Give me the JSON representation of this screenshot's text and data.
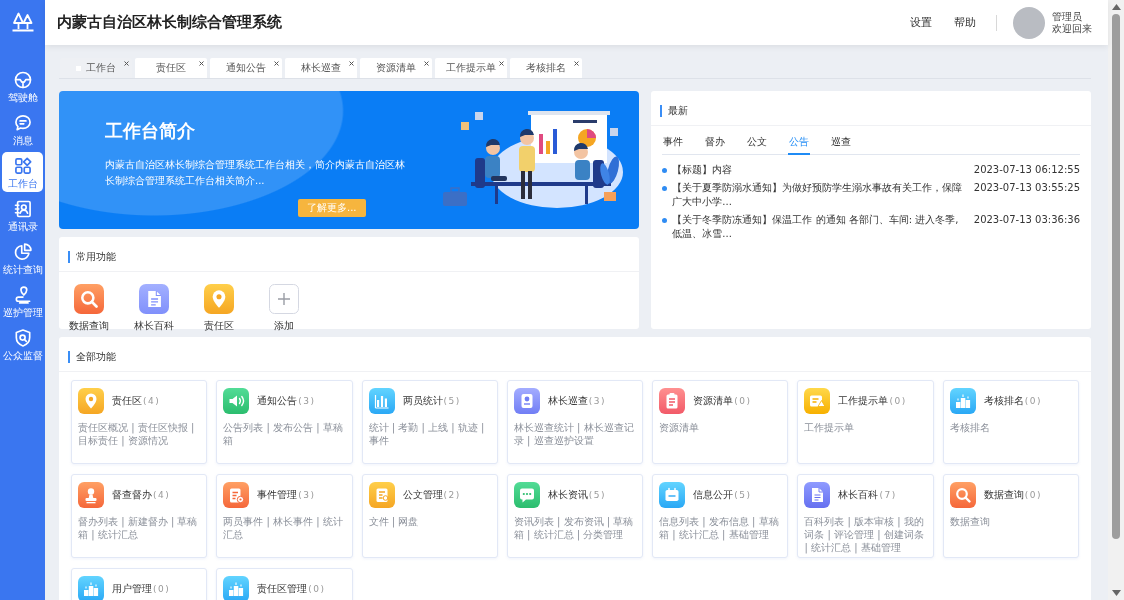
{
  "sidebar": {
    "items": [
      {
        "label": "驾驶舱",
        "selected": false
      },
      {
        "label": "消息",
        "selected": false
      },
      {
        "label": "工作台",
        "selected": true
      },
      {
        "label": "通讯录",
        "selected": false
      },
      {
        "label": "统计查询",
        "selected": false
      },
      {
        "label": "巡护管理",
        "selected": false
      },
      {
        "label": "公众监督",
        "selected": false
      }
    ]
  },
  "header": {
    "title": "内蒙古自治区林长制综合管理系统",
    "links": [
      "设置",
      "帮助"
    ],
    "user": {
      "name": "管理员",
      "greeting": "欢迎回来"
    }
  },
  "tabs": [
    {
      "label": "工作台",
      "selected": true
    },
    {
      "label": "责任区",
      "selected": false
    },
    {
      "label": "通知公告",
      "selected": false
    },
    {
      "label": "林长巡查",
      "selected": false
    },
    {
      "label": "资源清单",
      "selected": false
    },
    {
      "label": "工作提示单",
      "selected": false
    },
    {
      "label": "考核排名",
      "selected": false
    }
  ],
  "banner": {
    "title": "工作台简介",
    "description": "内蒙古自治区林长制综合管理系统工作台相关，简介内蒙古自治区林长制综合管理系统工作台相关简介...",
    "button": "了解更多..."
  },
  "news": {
    "title": "最新",
    "tabs": [
      {
        "label": "事件",
        "selected": false
      },
      {
        "label": "督办",
        "selected": false
      },
      {
        "label": "公文",
        "selected": false
      },
      {
        "label": "公告",
        "selected": true
      },
      {
        "label": "巡查",
        "selected": false
      }
    ],
    "items": [
      {
        "title": "【标题】内容",
        "date": "2023-07-13 06:12:55"
      },
      {
        "title": "【关于夏季防溺水通知】为做好预防学生溺水事故有关工作，保障广大中小学...",
        "date": "2023-07-13 03:55:25"
      },
      {
        "title": "【关于冬季防冻通知】保温工作 的通知 各部门、车间: 进入冬季,低温、冰雪...",
        "date": "2023-07-13 03:36:36"
      }
    ]
  },
  "common_functions": {
    "title": "常用功能",
    "items": [
      {
        "kind": "shortcut",
        "label": "数据查询"
      },
      {
        "kind": "shortcut",
        "label": "林长百科"
      },
      {
        "kind": "shortcut",
        "label": "责任区"
      },
      {
        "kind": "add",
        "label": "添加"
      }
    ]
  },
  "all_functions": {
    "title": "全部功能",
    "cards": [
      {
        "title": "责任区",
        "count": "(4)",
        "links": "责任区概况 | 责任区快报 | 目标责任 | 资源情况"
      },
      {
        "title": "通知公告",
        "count": "(3)",
        "links": "公告列表 | 发布公告 | 草稿箱"
      },
      {
        "title": "两员统计",
        "count": "(5)",
        "links": "统计 | 考勤 | 上线 | 轨迹 | 事件"
      },
      {
        "title": "林长巡查",
        "count": "(3)",
        "links": "林长巡查统计 | 林长巡查记录 | 巡查巡护设置"
      },
      {
        "title": "资源清单",
        "count": "(0)",
        "links": "资源清单"
      },
      {
        "title": "工作提示单",
        "count": "(0)",
        "links": "工作提示单"
      },
      {
        "title": "考核排名",
        "count": "(0)",
        "links": "考核排名"
      },
      {
        "title": "督查督办",
        "count": "(4)",
        "links": "督办列表 | 新建督办 | 草稿箱 | 统计汇总"
      },
      {
        "title": "事件管理",
        "count": "(3)",
        "links": "两员事件 | 林长事件 | 统计汇总"
      },
      {
        "title": "公文管理",
        "count": "(2)",
        "links": "文件 | 网盘"
      },
      {
        "title": "林长资讯",
        "count": "(5)",
        "links": "资讯列表 | 发布资讯 | 草稿箱 | 统计汇总 | 分类管理"
      },
      {
        "title": "信息公开",
        "count": "(5)",
        "links": "信息列表 | 发布信息 | 草稿箱 | 统计汇总 | 基础管理"
      },
      {
        "title": "林长百科",
        "count": "(7)",
        "links": "百科列表 | 版本审核 | 我的词条 | 评论管理 | 创建词条 | 统计汇总 | 基础管理"
      },
      {
        "title": "数据查询",
        "count": "(0)",
        "links": "数据查询"
      },
      {
        "title": "用户管理",
        "count": "(0)"
      },
      {
        "title": "责任区管理",
        "count": "(0)"
      }
    ]
  }
}
